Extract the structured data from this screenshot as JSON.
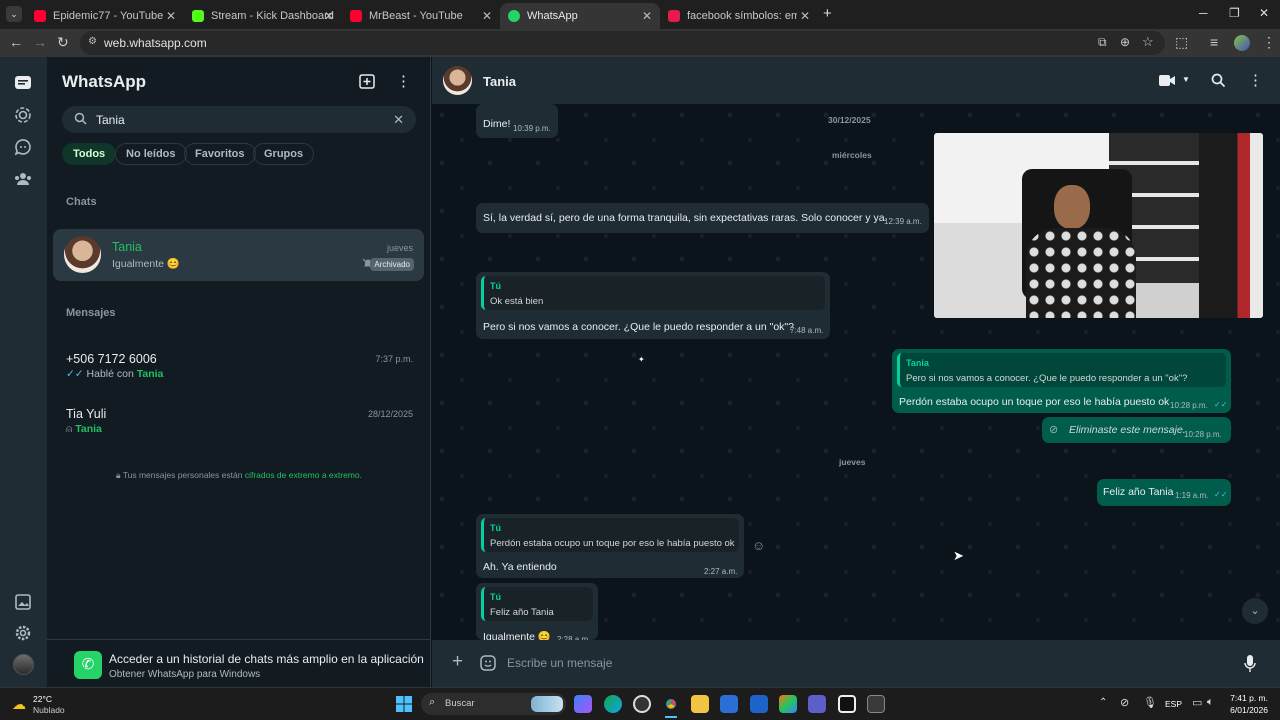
{
  "browser": {
    "tabs": [
      {
        "label": "Epidemic77 - YouTube",
        "color": "#ff0033"
      },
      {
        "label": "Stream - Kick Dashboard",
        "color": "#53fc18"
      },
      {
        "label": "MrBeast - YouTube",
        "color": "#ff0033"
      },
      {
        "label": "WhatsApp",
        "color": "#25d366"
      },
      {
        "label": "facebook símbolos: emoticones",
        "color": "#e8194c"
      }
    ],
    "url": "web.whatsapp.com"
  },
  "sidebar": {
    "title": "WhatsApp",
    "search_value": "Tania",
    "filters": [
      "Todos",
      "No leídos",
      "Favoritos",
      "Grupos"
    ],
    "chats_label": "Chats",
    "chat": {
      "name": "Tania",
      "preview": "Igualmente 😊",
      "time": "jueves",
      "badge": "Archivado"
    },
    "messages_label": "Mensajes",
    "messages": [
      {
        "name": "+506 7172 6006",
        "time": "7:37 p.m.",
        "prefix": "Hablé con ",
        "highlight": "Tania"
      },
      {
        "name": "Tia Yuli",
        "time": "28/12/2025",
        "highlight": "Tania"
      }
    ],
    "encryption_prefix": "Tus mensajes personales están ",
    "encryption_link": "cifrados de extremo a extremo",
    "encryption_suffix": ".",
    "promo_title": "Acceder a un historial de chats más amplio en la aplicación",
    "promo_sub": "Obtener WhatsApp para Windows"
  },
  "conversation": {
    "contact": "Tania",
    "messages": {
      "m1": {
        "text": "Dime!",
        "time": "10:39 p.m."
      },
      "day1": "30/12/2025",
      "day2": "miércoles",
      "m2": {
        "text": "Sí, la verdad sí, pero de una forma tranquila, sin expectativas raras. Solo conocer y ya.",
        "time": "12:39 a.m."
      },
      "m3": {
        "quote_author": "Tú",
        "quote_text": "Ok está bien",
        "text": "Pero si nos vamos a conocer. ¿Que le puedo responder a un \"ok\"?",
        "time": "7:48 a.m."
      },
      "m4": {
        "quote_author": "Tania",
        "quote_text": "Pero si nos vamos a conocer. ¿Que le puedo responder a un \"ok\"?",
        "text": "Perdón estaba ocupo un toque por eso le había puesto ok",
        "time": "10:28 p.m."
      },
      "m5": {
        "text": "Eliminaste este mensaje.",
        "time": "10:28 p.m."
      },
      "day3": "jueves",
      "m6": {
        "text": "Feliz año Tania",
        "time": "1:19 a.m."
      },
      "m7": {
        "quote_author": "Tú",
        "quote_text": "Perdón estaba ocupo un toque por eso le había puesto ok",
        "text": "Ah. Ya entiendo",
        "time": "2:27 a.m."
      },
      "m8": {
        "quote_author": "Tú",
        "quote_text": "Feliz año Tania",
        "text": "Igualmente 😊",
        "time": "2:28 a.m."
      }
    },
    "composer_placeholder": "Escribe un mensaje"
  },
  "taskbar": {
    "weather_temp": "22°C",
    "weather_desc": "Nublado",
    "search_label": "Buscar",
    "lang": "ESP",
    "time": "7:41 p. m.",
    "date": "6/01/2026"
  }
}
